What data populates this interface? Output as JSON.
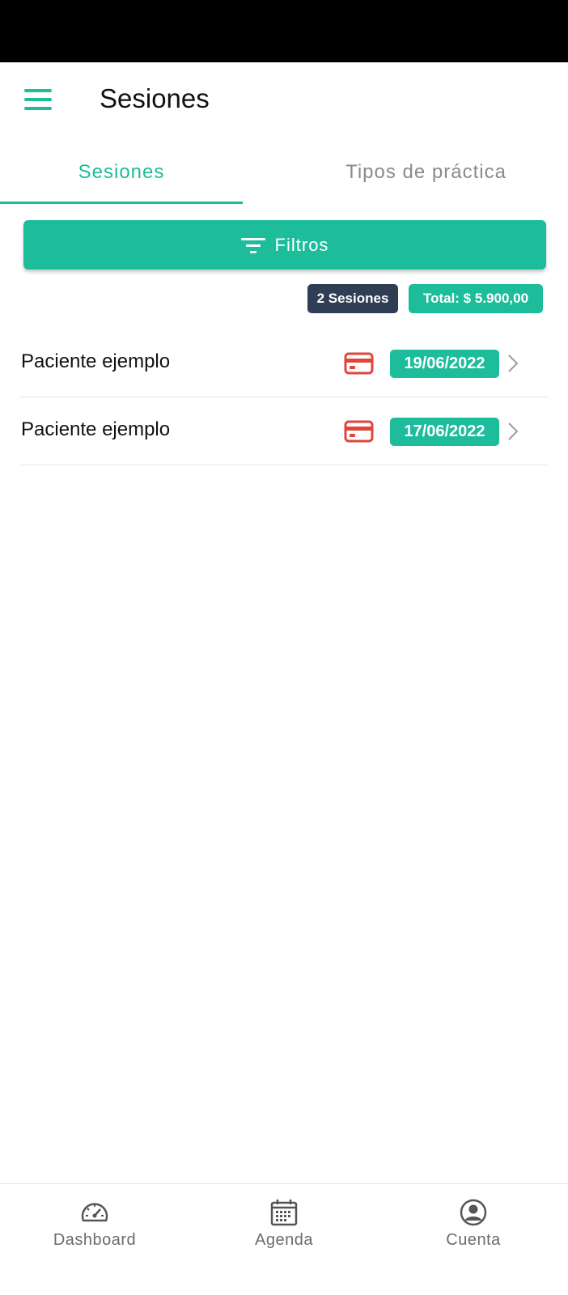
{
  "app_bar": {
    "title": "Sesiones",
    "menu_icon": "hamburger-menu-icon"
  },
  "tabs": [
    {
      "label": "Sesiones",
      "active": true
    },
    {
      "label": "Tipos de práctica",
      "active": false
    }
  ],
  "filter_button": {
    "label": "Filtros",
    "icon": "filter-icon"
  },
  "summary": {
    "count": "2 Sesiones",
    "total": "Total: $ 5.900,00"
  },
  "sessions": [
    {
      "patient": "Paciente ejemplo",
      "date": "19/06/2022",
      "payment_icon": "credit-card-icon"
    },
    {
      "patient": "Paciente ejemplo",
      "date": "17/06/2022",
      "payment_icon": "credit-card-icon"
    }
  ],
  "bottom_nav": [
    {
      "label": "Dashboard",
      "icon": "speedometer-icon"
    },
    {
      "label": "Agenda",
      "icon": "calendar-icon"
    },
    {
      "label": "Cuenta",
      "icon": "account-circle-icon"
    }
  ],
  "colors": {
    "accent": "#1dbc9b",
    "dark_badge": "#2f3e55",
    "card_icon": "#e0463c"
  }
}
